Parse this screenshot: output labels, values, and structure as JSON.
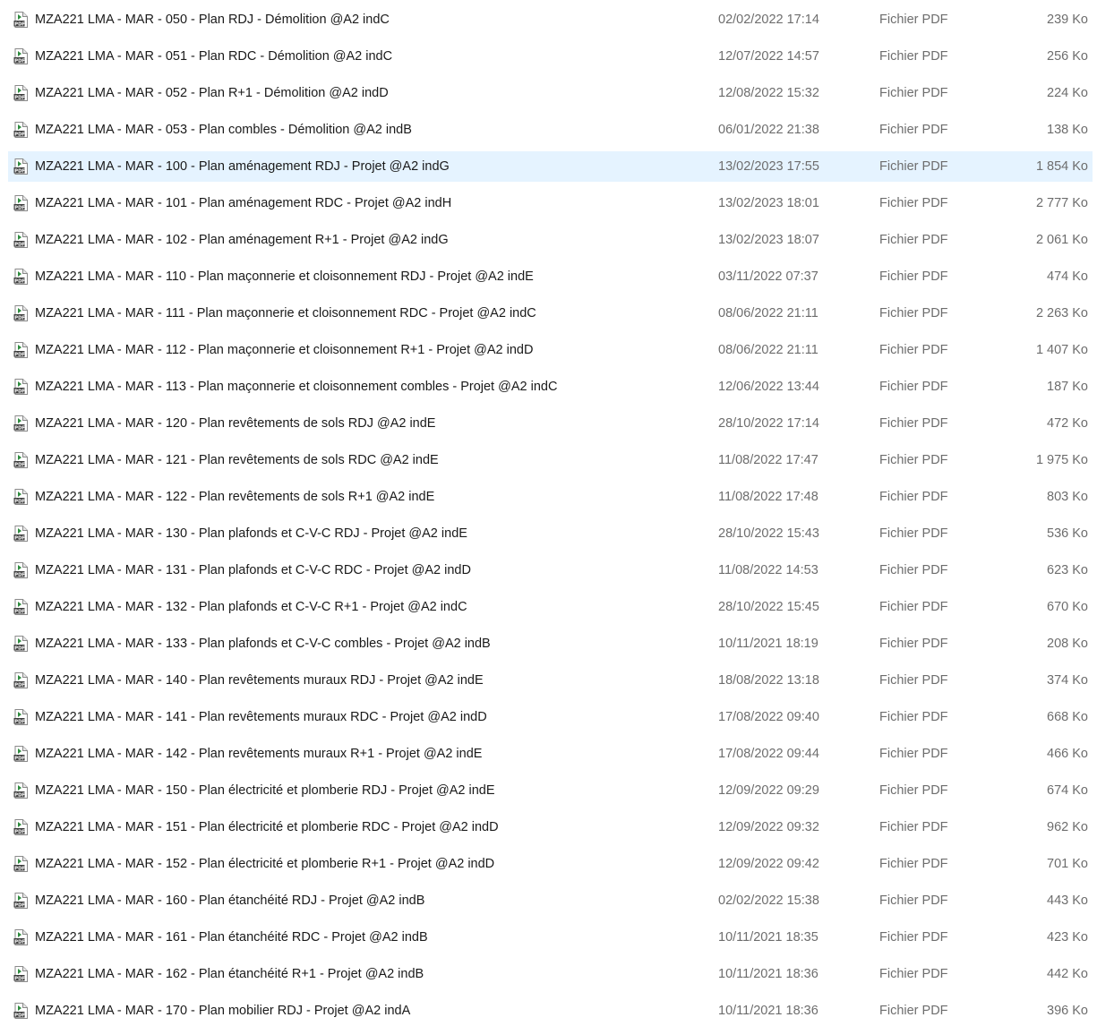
{
  "selected_index": 4,
  "colors": {
    "selected_row": "#e5f3ff",
    "secondary_text": "#6d6d6d",
    "pdf_icon_accent": "#2e8b3e"
  },
  "icon": "pdf-file-icon",
  "files": [
    {
      "name": "MZA221 LMA - MAR - 050 - Plan RDJ - Démolition  @A2 indC",
      "date": "02/02/2022 17:14",
      "type": "Fichier PDF",
      "size": "239 Ko"
    },
    {
      "name": "MZA221 LMA - MAR - 051 - Plan RDC - Démolition  @A2 indC",
      "date": "12/07/2022 14:57",
      "type": "Fichier PDF",
      "size": "256 Ko"
    },
    {
      "name": "MZA221 LMA - MAR - 052 - Plan R+1 - Démolition  @A2 indD",
      "date": "12/08/2022 15:32",
      "type": "Fichier PDF",
      "size": "224 Ko"
    },
    {
      "name": "MZA221 LMA - MAR - 053 - Plan combles - Démolition  @A2 indB",
      "date": "06/01/2022 21:38",
      "type": "Fichier PDF",
      "size": "138 Ko"
    },
    {
      "name": "MZA221 LMA - MAR - 100 - Plan aménagement RDJ - Projet  @A2 indG",
      "date": "13/02/2023 17:55",
      "type": "Fichier PDF",
      "size": "1 854 Ko"
    },
    {
      "name": "MZA221 LMA - MAR - 101 - Plan aménagement RDC - Projet  @A2 indH",
      "date": "13/02/2023 18:01",
      "type": "Fichier PDF",
      "size": "2 777 Ko"
    },
    {
      "name": "MZA221 LMA - MAR - 102 - Plan aménagement R+1 - Projet  @A2 indG",
      "date": "13/02/2023 18:07",
      "type": "Fichier PDF",
      "size": "2 061 Ko"
    },
    {
      "name": "MZA221 LMA - MAR - 110 - Plan maçonnerie et cloisonnement RDJ - Projet  @A2 indE",
      "date": "03/11/2022 07:37",
      "type": "Fichier PDF",
      "size": "474 Ko"
    },
    {
      "name": "MZA221 LMA - MAR - 111 - Plan maçonnerie et cloisonnement RDC - Projet  @A2 indC",
      "date": "08/06/2022 21:11",
      "type": "Fichier PDF",
      "size": "2 263 Ko"
    },
    {
      "name": "MZA221 LMA - MAR - 112 - Plan maçonnerie et cloisonnement R+1 - Projet  @A2  indD",
      "date": "08/06/2022 21:11",
      "type": "Fichier PDF",
      "size": "1 407 Ko"
    },
    {
      "name": "MZA221 LMA - MAR - 113 - Plan maçonnerie et cloisonnement combles - Projet  @A2 indC",
      "date": "12/06/2022 13:44",
      "type": "Fichier PDF",
      "size": "187 Ko"
    },
    {
      "name": "MZA221 LMA - MAR - 120 - Plan revêtements de sols RDJ  @A2  indE",
      "date": "28/10/2022 17:14",
      "type": "Fichier PDF",
      "size": "472 Ko"
    },
    {
      "name": "MZA221 LMA - MAR - 121 - Plan revêtements de sols RDC  @A2 indE",
      "date": "11/08/2022 17:47",
      "type": "Fichier PDF",
      "size": "1 975 Ko"
    },
    {
      "name": "MZA221 LMA - MAR - 122 - Plan revêtements de sols R+1  @A2  indE",
      "date": "11/08/2022 17:48",
      "type": "Fichier PDF",
      "size": "803 Ko"
    },
    {
      "name": "MZA221 LMA - MAR - 130 - Plan plafonds et C-V-C RDJ - Projet  @A2  indE",
      "date": "28/10/2022 15:43",
      "type": "Fichier PDF",
      "size": "536 Ko"
    },
    {
      "name": "MZA221 LMA - MAR - 131 - Plan plafonds et C-V-C RDC - Projet  @A2  indD",
      "date": "11/08/2022 14:53",
      "type": "Fichier PDF",
      "size": "623 Ko"
    },
    {
      "name": "MZA221 LMA - MAR - 132 - Plan plafonds et C-V-C R+1 - Projet  @A2  indC",
      "date": "28/10/2022 15:45",
      "type": "Fichier PDF",
      "size": "670 Ko"
    },
    {
      "name": "MZA221 LMA - MAR - 133 - Plan plafonds et C-V-C combles - Projet  @A2 indB",
      "date": "10/11/2021 18:19",
      "type": "Fichier PDF",
      "size": "208 Ko"
    },
    {
      "name": "MZA221 LMA - MAR - 140 - Plan revêtements muraux RDJ - Projet  @A2  indE",
      "date": "18/08/2022 13:18",
      "type": "Fichier PDF",
      "size": "374 Ko"
    },
    {
      "name": "MZA221 LMA - MAR - 141 - Plan revêtements muraux RDC - Projet  @A2  indD",
      "date": "17/08/2022 09:40",
      "type": "Fichier PDF",
      "size": "668 Ko"
    },
    {
      "name": "MZA221 LMA - MAR - 142 - Plan revêtements muraux R+1 - Projet  @A2  indE",
      "date": "17/08/2022 09:44",
      "type": "Fichier PDF",
      "size": "466 Ko"
    },
    {
      "name": "MZA221 LMA - MAR - 150 - Plan électricité et plomberie RDJ - Projet  @A2  indE",
      "date": "12/09/2022 09:29",
      "type": "Fichier PDF",
      "size": "674 Ko"
    },
    {
      "name": "MZA221 LMA - MAR - 151 - Plan électricité et plomberie RDC - Projet  @A2  indD",
      "date": "12/09/2022 09:32",
      "type": "Fichier PDF",
      "size": "962 Ko"
    },
    {
      "name": "MZA221 LMA - MAR - 152 - Plan électricité et plomberie R+1 - Projet  @A2  indD",
      "date": "12/09/2022 09:42",
      "type": "Fichier PDF",
      "size": "701 Ko"
    },
    {
      "name": "MZA221 LMA - MAR - 160 - Plan étanchéité RDJ - Projet  @A2 indB",
      "date": "02/02/2022 15:38",
      "type": "Fichier PDF",
      "size": "443 Ko"
    },
    {
      "name": "MZA221 LMA - MAR - 161 - Plan étanchéité RDC - Projet  @A2 indB",
      "date": "10/11/2021 18:35",
      "type": "Fichier PDF",
      "size": "423 Ko"
    },
    {
      "name": "MZA221 LMA - MAR - 162 - Plan étanchéité R+1 - Projet  @A2  indB",
      "date": "10/11/2021 18:36",
      "type": "Fichier PDF",
      "size": "442 Ko"
    },
    {
      "name": "MZA221 LMA - MAR - 170 - Plan mobilier RDJ - Projet @A2 indA",
      "date": "10/11/2021 18:36",
      "type": "Fichier PDF",
      "size": "396 Ko"
    }
  ]
}
